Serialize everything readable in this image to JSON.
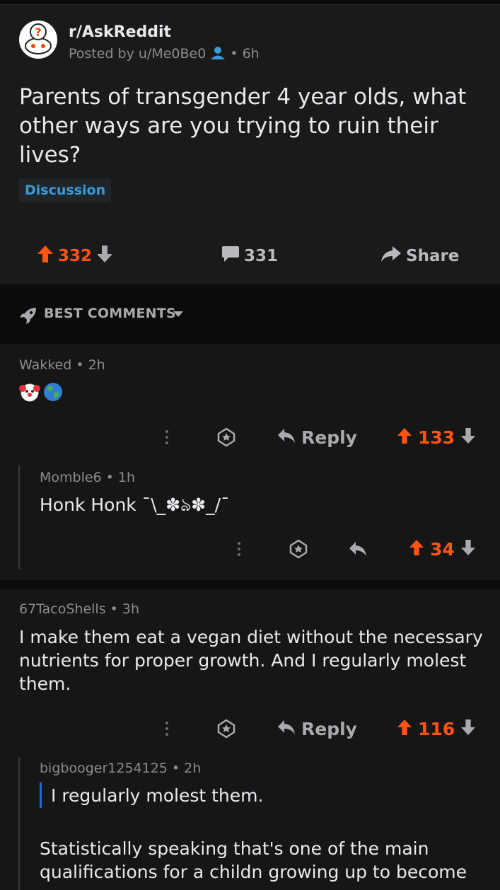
{
  "post": {
    "subreddit": "r/AskReddit",
    "posted_by": "Posted by u/Me0Be0",
    "age": "• 6h",
    "title": "Parents of transgender 4 year olds, what other ways are you trying to ruin their lives?",
    "flair": "Discussion",
    "score": "332",
    "comments": "331",
    "share_label": "Share"
  },
  "sort": {
    "label": "BEST COMMENTS"
  },
  "comments": [
    {
      "author_meta": "Wakked • 2h",
      "emoji": [
        "🤡",
        "🌍"
      ],
      "reply_label": "Reply",
      "score": "133",
      "replies": [
        {
          "author_meta": "Momble6 • 1h",
          "text": "Honk Honk ¯\\_✽ঌ✽_/¯",
          "score": "34"
        }
      ]
    },
    {
      "author_meta": "67TacoShells • 3h",
      "text": "I make them eat a vegan diet without the necessary nutrients for proper growth. And I regularly molest them.",
      "reply_label": "Reply",
      "score": "116",
      "replies": [
        {
          "author_meta": "bigbooger1254125 • 2h",
          "quote": "I regularly molest them.",
          "text": "Statistically speaking that's one of the main qualifications for a childn growing up to become"
        }
      ]
    }
  ],
  "colors": {
    "upvote": "#ff5414",
    "link": "#3a9ad9",
    "quote": "#1f6bd6"
  }
}
